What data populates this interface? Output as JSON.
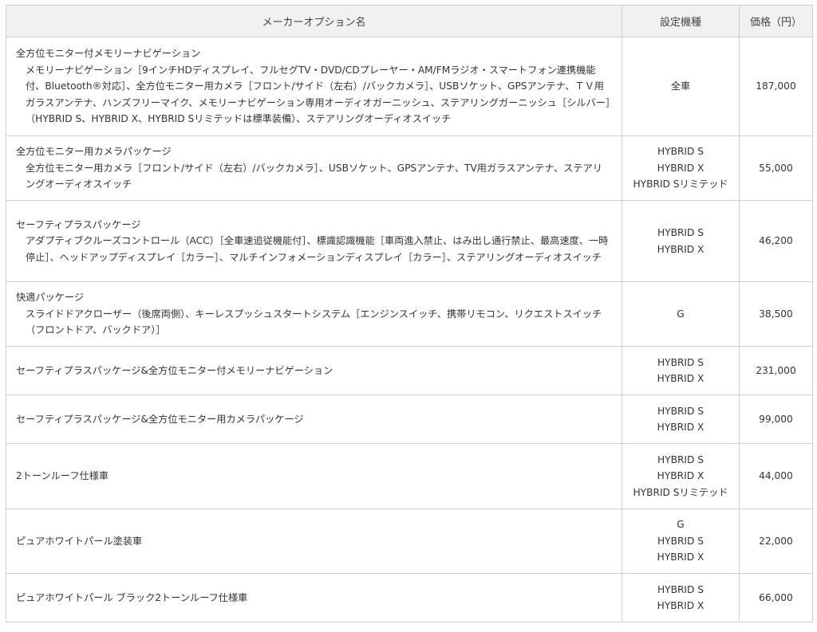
{
  "table": {
    "headers": {
      "name": "メーカーオプション名",
      "models": "設定機種",
      "price": "価格（円）"
    },
    "rows": [
      {
        "title": "全方位モニター付メモリーナビゲーション",
        "detail": "メモリーナビゲーション［9インチHDディスプレイ、フルセグTV・DVD/CDプレーヤー・AM/FMラジオ・スマートフォン連携機能付、Bluetooth®対応］、全方位モニター用カメラ［フロント/サイド（左右）/バックカメラ］、USBソケット、GPSアンテナ、ＴＶ用ガラスアンテナ、ハンズフリーマイク、メモリーナビゲーション専用オーディオガーニッシュ、ステアリングガーニッシュ［シルバー］（HYBRID S、HYBRID X、HYBRID Sリミテッドは標準装備）、ステアリングオーディオスイッチ",
        "models": [
          "全車"
        ],
        "price": "187,000"
      },
      {
        "title": "全方位モニター用カメラパッケージ",
        "detail": "全方位モニター用カメラ［フロント/サイド（左右）/バックカメラ］、USBソケット、GPSアンテナ、TV用ガラスアンテナ、ステアリングオーディオスイッチ",
        "models": [
          "HYBRID S",
          "HYBRID X",
          "HYBRID Sリミテッド"
        ],
        "price": "55,000"
      },
      {
        "title": "セーフティプラスパッケージ",
        "detail": "アダプティブクルーズコントロール（ACC）［全車速追従機能付］、標識認識機能［車両進入禁止、はみ出し通行禁止、最高速度、一時停止］、ヘッドアップディスプレイ［カラー］、マルチインフォメーションディスプレイ［カラー］、ステアリングオーディオスイッチ",
        "models": [
          "HYBRID S",
          "HYBRID X"
        ],
        "price": "46,200"
      },
      {
        "title": "快適パッケージ",
        "detail": "スライドドアクローザー（後席両側）、キーレスプッシュスタートシステム［エンジンスイッチ、携帯リモコン、リクエストスイッチ（フロントドア、バックドア）］",
        "models": [
          "G"
        ],
        "price": "38,500"
      },
      {
        "title": "セーフティプラスパッケージ&全方位モニター付メモリーナビゲーション",
        "detail": "",
        "models": [
          "HYBRID S",
          "HYBRID X"
        ],
        "price": "231,000"
      },
      {
        "title": "セーフティプラスパッケージ&全方位モニター用カメラパッケージ",
        "detail": "",
        "models": [
          "HYBRID S",
          "HYBRID X"
        ],
        "price": "99,000"
      },
      {
        "title": "2トーンルーフ仕様車",
        "detail": "",
        "models": [
          "HYBRID S",
          "HYBRID X",
          "HYBRID Sリミテッド"
        ],
        "price": "44,000"
      },
      {
        "title": "ピュアホワイトパール塗装車",
        "detail": "",
        "models": [
          "G",
          "HYBRID S",
          "HYBRID X"
        ],
        "price": "22,000"
      },
      {
        "title": "ピュアホワイトパール ブラック2トーンルーフ仕様車",
        "detail": "",
        "models": [
          "HYBRID S",
          "HYBRID X"
        ],
        "price": "66,000"
      }
    ]
  }
}
